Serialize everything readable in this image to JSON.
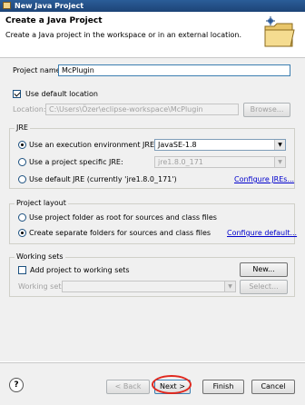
{
  "window": {
    "title": "New Java Project"
  },
  "header": {
    "title": "Create a Java Project",
    "description": "Create a Java project in the workspace or in an external location."
  },
  "project": {
    "name_label": "Project name:",
    "name_value": "McPlugin",
    "use_default_location_label": "Use default location",
    "use_default_location_checked": true,
    "location_label": "Location:",
    "location_value": "C:\\Users\\Özer\\eclipse-workspace\\McPlugin",
    "browse_label": "Browse..."
  },
  "jre": {
    "group_label": "JRE",
    "options": [
      {
        "label": "Use an execution environment JRE:",
        "selected": true,
        "combo_value": "JavaSE-1.8"
      },
      {
        "label": "Use a project specific JRE:",
        "selected": false,
        "combo_value": "jre1.8.0_171"
      },
      {
        "label": "Use default JRE (currently 'jre1.8.0_171')",
        "selected": false
      }
    ],
    "configure_link": "Configure JREs..."
  },
  "layout": {
    "group_label": "Project layout",
    "options": [
      {
        "label": "Use project folder as root for sources and class files",
        "selected": false
      },
      {
        "label": "Create separate folders for sources and class files",
        "selected": true
      }
    ],
    "configure_link": "Configure default..."
  },
  "working_sets": {
    "group_label": "Working sets",
    "add_label": "Add project to working sets",
    "add_checked": false,
    "new_button": "New...",
    "sets_label": "Working sets:",
    "select_button": "Select..."
  },
  "footer": {
    "help": "?",
    "back": "< Back",
    "next": "Next >",
    "finish": "Finish",
    "cancel": "Cancel"
  }
}
